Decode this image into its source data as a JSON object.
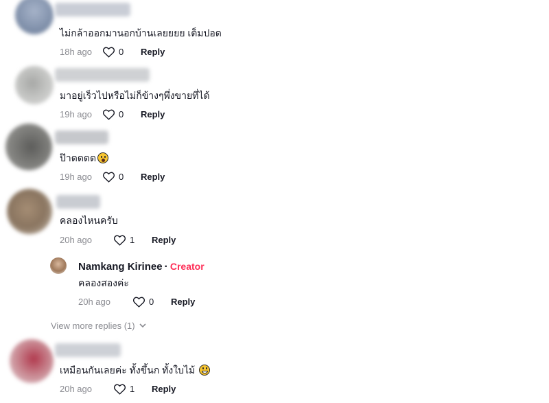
{
  "comments": [
    {
      "text": "ไม่กล้าออกมานอกบ้านเลยยยย เต็มปอด",
      "time": "18h ago",
      "likes": "0",
      "reply": "Reply"
    },
    {
      "text": "มาอยู่เร็วไปหรือไม่ก็ข้างๆพึ่งขายที่ได้",
      "time": "19h ago",
      "likes": "0",
      "reply": "Reply"
    },
    {
      "text": "ป๊าดดดด",
      "time": "19h ago",
      "likes": "0",
      "reply": "Reply",
      "emoji": "surprised-face-emoji"
    },
    {
      "text": "คลองไหนครับ",
      "time": "20h ago",
      "likes": "1",
      "reply": "Reply"
    },
    {
      "text": "เหมือนกันเลยค่ะ ทั้งขึ้นก ทั้งใบไม้",
      "time": "20h ago",
      "likes": "1",
      "reply": "Reply",
      "emoji": "grinning-sweat-emoji"
    }
  ],
  "creator_reply": {
    "name": "Namkang Kirinee",
    "separator": "·",
    "tag": "Creator",
    "text": "คลองสองค่ะ",
    "time": "20h ago",
    "likes": "0",
    "reply": "Reply"
  },
  "view_more": "View more replies (1)",
  "colors": {
    "accent": "#fe2c55",
    "muted": "#8a8b91",
    "text": "#161823"
  }
}
